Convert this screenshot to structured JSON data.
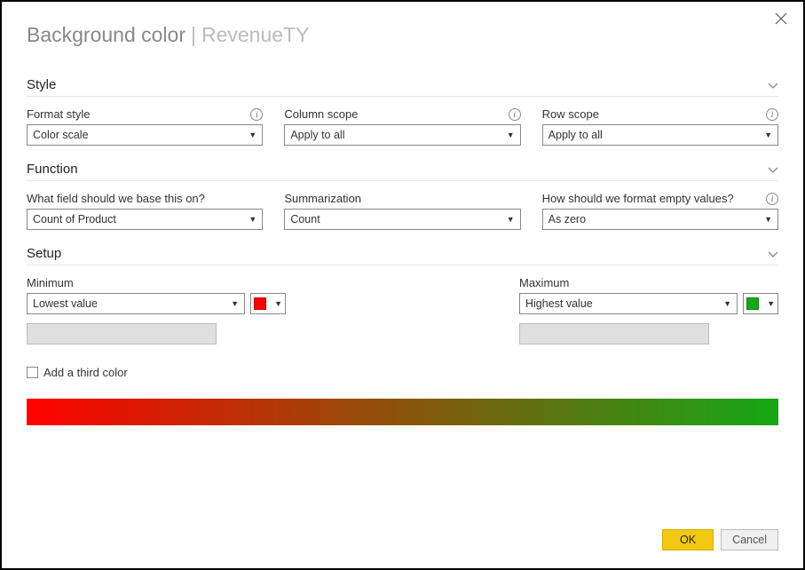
{
  "header": {
    "title": "Background color",
    "separator": "|",
    "subtitle": "RevenueTY"
  },
  "sections": {
    "style": {
      "label": "Style",
      "format_style": {
        "label": "Format style",
        "value": "Color scale"
      },
      "column_scope": {
        "label": "Column scope",
        "value": "Apply to all"
      },
      "row_scope": {
        "label": "Row scope",
        "value": "Apply to all"
      }
    },
    "function": {
      "label": "Function",
      "base_field": {
        "label": "What field should we base this on?",
        "value": "Count of Product"
      },
      "summarization": {
        "label": "Summarization",
        "value": "Count"
      },
      "empty_values": {
        "label": "How should we format empty values?",
        "value": "As zero"
      }
    },
    "setup": {
      "label": "Setup",
      "minimum": {
        "label": "Minimum",
        "value": "Lowest value",
        "color": "#ff0000"
      },
      "maximum": {
        "label": "Maximum",
        "value": "Highest value",
        "color": "#15a815"
      },
      "add_third_color": "Add a third color"
    }
  },
  "gradient": {
    "start": "#ff0000",
    "end": "#15a815"
  },
  "buttons": {
    "ok": "OK",
    "cancel": "Cancel"
  }
}
